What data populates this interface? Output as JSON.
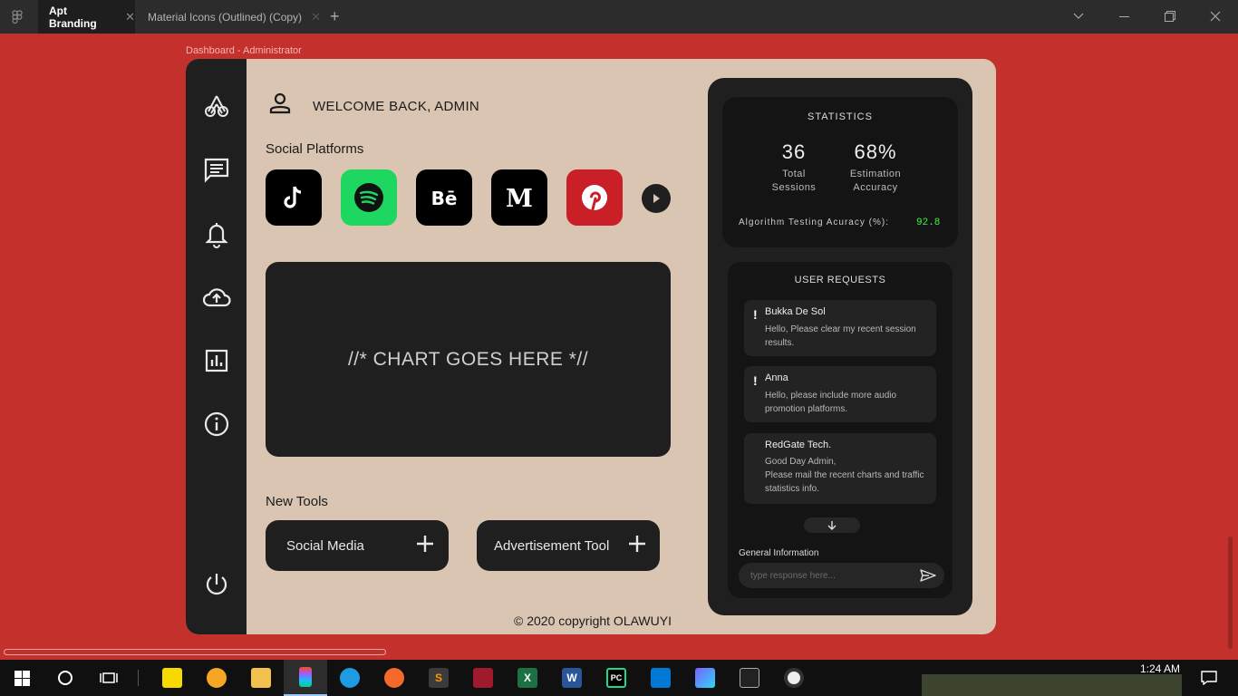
{
  "window": {
    "tabs": [
      {
        "label": "Apt Branding",
        "active": true
      },
      {
        "label": "Material Icons (Outlined) (Copy)",
        "active": false
      }
    ],
    "close_glyph": "✕",
    "add_glyph": "+"
  },
  "frame": {
    "label": "Dashboard - Administrator"
  },
  "sidebar": {
    "items": [
      "logo-icon",
      "messages-icon",
      "notifications-icon",
      "cloud-upload-icon",
      "analytics-icon",
      "info-icon",
      "power-icon"
    ]
  },
  "header": {
    "welcome": "WELCOME BACK, ADMIN"
  },
  "social": {
    "title": "Social Platforms",
    "platforms": [
      {
        "name": "TikTok",
        "color": "#000000"
      },
      {
        "name": "Spotify",
        "color": "#1ed760"
      },
      {
        "name": "Behance",
        "color": "#000000"
      },
      {
        "name": "Medium",
        "color": "#000000"
      },
      {
        "name": "Pinterest",
        "color": "#cb1f27"
      }
    ]
  },
  "chart": {
    "placeholder": "//* CHART GOES HERE *//"
  },
  "tools": {
    "title": "New Tools",
    "items": [
      {
        "label": "Social Media"
      },
      {
        "label": "Advertisement Tool"
      }
    ]
  },
  "footer": {
    "copyright": "© 2020 copyright OLAWUYI"
  },
  "statistics": {
    "title": "STATISTICS",
    "sessions": {
      "value": "36",
      "line1": "Total",
      "line2": "Sessions"
    },
    "accuracy": {
      "value": "68%",
      "line1": "Estimation",
      "line2": "Accuracy"
    },
    "algo_label": "Algorithm Testing Acuracy (%):",
    "algo_value": "92.8",
    "algo_color": "#3ff23f"
  },
  "requests": {
    "title": "USER REQUESTS",
    "items": [
      {
        "name": "Bukka De Sol",
        "message": "Hello, Please clear my recent session results.",
        "flagged": true
      },
      {
        "name": "Anna",
        "message": "Hello, please include more audio promotion platforms.",
        "flagged": true
      },
      {
        "name": "RedGate Tech.",
        "line1": "Good Day Admin,",
        "line2": "Please mail the recent charts and traffic statistics info.",
        "flagged": false
      }
    ],
    "flag_glyph": "!",
    "general_label": "General Information",
    "reply_placeholder": "type response here..."
  },
  "taskbar": {
    "time": "1:24 AM",
    "apps": [
      "start",
      "cortana",
      "task-view",
      "sticky-notes",
      "bitwarden",
      "file-explorer",
      "figma",
      "edge",
      "postman",
      "sublime-text",
      "mendeley",
      "excel",
      "word",
      "pycharm",
      "vscode",
      "app",
      "terminal",
      "music"
    ]
  },
  "colors": {
    "background": "#c4302b",
    "card": "#d9c5b2",
    "dark": "#1f1f1f"
  }
}
